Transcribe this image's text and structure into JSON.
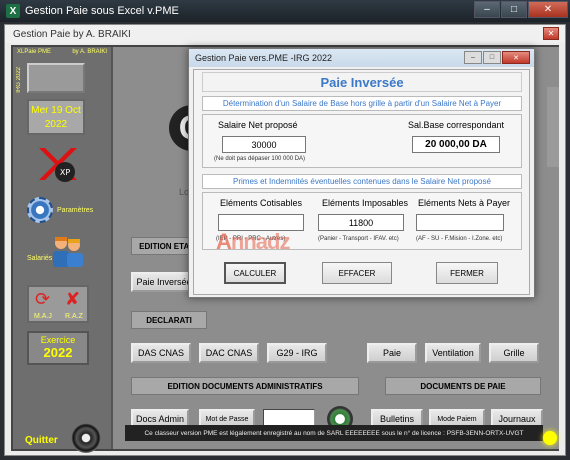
{
  "window": {
    "app_icon": "X",
    "title": "Gestion Paie sous Excel v.PME",
    "ctrl_min": "–",
    "ctrl_max": "□",
    "ctrl_close": "✕"
  },
  "userform": {
    "title": "Gestion Paie by A. BRAIKI",
    "close": "✕"
  },
  "left": {
    "header_left": "XLPaie PME",
    "header_right": "by A. BRAIKI",
    "vertical_label": "IRG 2022",
    "date_line1": "Mer 19 Oct",
    "date_line2": "2022",
    "parametres": "Paramètres",
    "salaries": "Salariés",
    "maj": "M.A.J",
    "raz": "R.A.Z",
    "exercice_label": "Exercice",
    "exercice_year": "2022",
    "quit": "Quitter",
    "logo_text": "XP"
  },
  "canvas": {
    "bg_logo": "G",
    "bg_lors": "Lors",
    "edition_etats": "EDITION ETATS",
    "paie_inversee_btn": "Paie Inversée",
    "declarations": "DECLARATI",
    "das_cnas": "DAS CNAS",
    "dac_cnas": "DAC CNAS",
    "g29_irg": "G29 - IRG",
    "paie": "Paie",
    "ventilation": "Ventilation",
    "grille": "Grille",
    "edition_docs": "EDITION DOCUMENTS ADMINISTRATIFS",
    "documents_paie": "DOCUMENTS DE PAIE",
    "docs_admin": "Docs Admin",
    "mot_de_passe": "Mot de Passe",
    "bulletins": "Bulletins",
    "mode_paiem": "Mode Paiem",
    "journaux": "Journaux",
    "footer": "Ce classeur version PME est légalement enregistré au nom de SARL EEEEEEEE sous le n° de licence : PSFB-3ENN-ORTX-UVGT"
  },
  "dialog": {
    "title": "Gestion Paie vers.PME -IRG 2022",
    "heading": "Paie Inversée",
    "subhead1": "Détermination d'un Salaire de Base hors grille à partir d'un Salaire Net à Payer",
    "salaire_net_label": "Salaire Net proposé",
    "salaire_net_value": "30000",
    "salaire_net_note": "(Ne doit pas dépaser 100 000 DA)",
    "sal_base_label": "Sal.Base correspondant",
    "sal_base_value": "20 000,00 DA",
    "subhead2": "Primes et Indemnités éventuelles contenues dans le Salaire Net proposé",
    "cotisables_label": "Eléments Cotisables",
    "cotisables_note": "(IEP - PRI - PRC - Autres)",
    "imposables_label": "Eléments Imposables",
    "imposables_value": "11800",
    "imposables_note": "(Panier - Transport - IFAV. etc)",
    "nets_label": "Eléments Nets à Payer",
    "nets_note": "(AF - SU - F.Mision - I.Zone. etc)",
    "calculer": "CALCULER",
    "effacer": "EFFACER",
    "fermer": "FERMER",
    "watermark_a": "A",
    "watermark_rest": "nnadz"
  }
}
